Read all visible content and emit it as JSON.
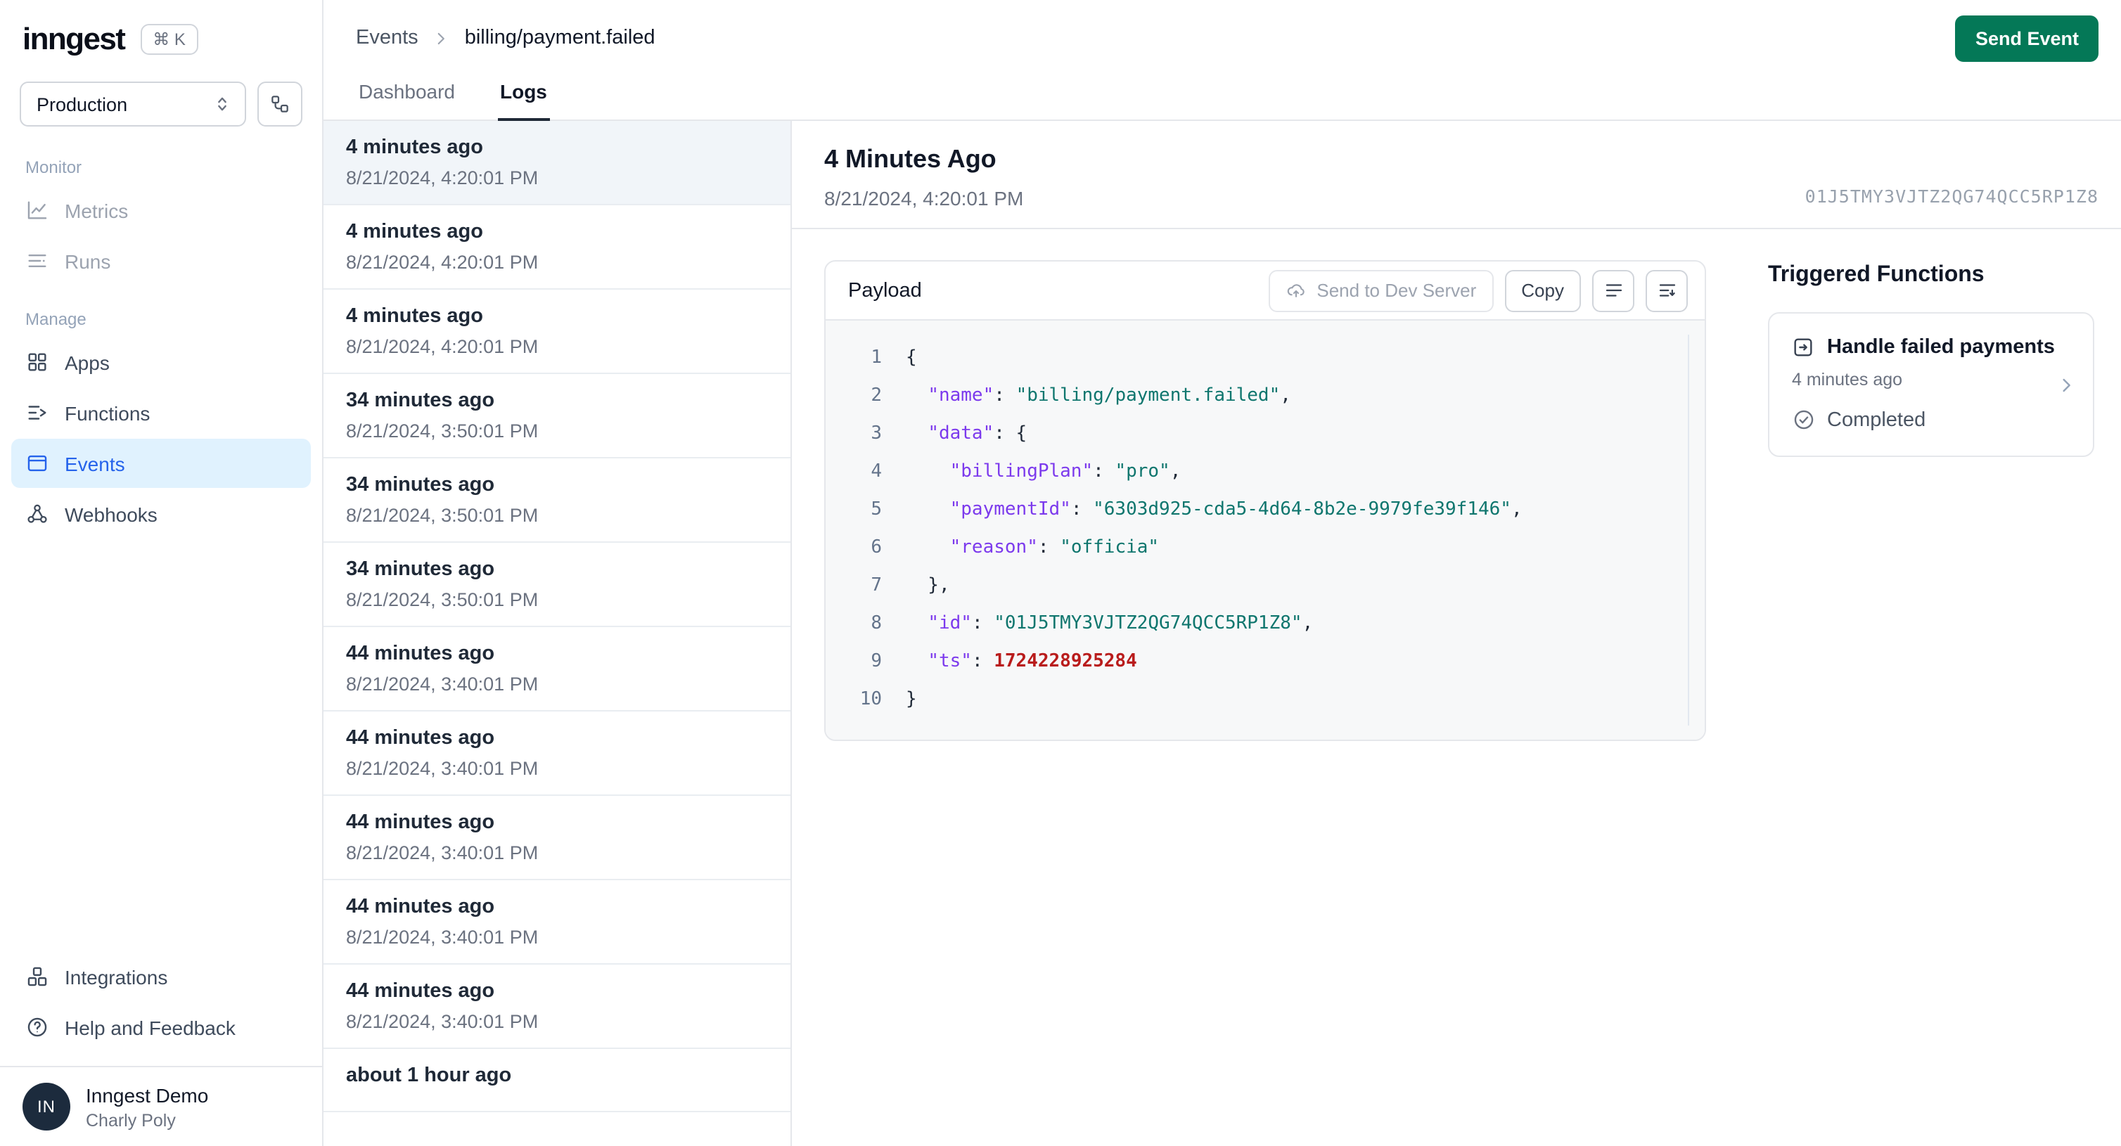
{
  "colors": {
    "accent_green": "#047857",
    "active_blue": "#2563eb",
    "active_blue_bg": "#e0f2fe",
    "selected_item_bg": "#f1f5f9",
    "code_key": "#7c3aed",
    "code_string": "#0f766e",
    "code_number": "#b91c1c",
    "avatar_bg": "#1c2b3d"
  },
  "sidebar": {
    "logo": "inngest",
    "shortcut": "⌘ K",
    "environment": {
      "value": "Production"
    },
    "sections": [
      {
        "label": "Monitor",
        "items": [
          {
            "label": "Metrics",
            "icon": "metrics-icon"
          },
          {
            "label": "Runs",
            "icon": "runs-icon"
          }
        ]
      },
      {
        "label": "Manage",
        "items": [
          {
            "label": "Apps",
            "icon": "apps-icon"
          },
          {
            "label": "Functions",
            "icon": "functions-icon"
          },
          {
            "label": "Events",
            "icon": "events-icon"
          },
          {
            "label": "Webhooks",
            "icon": "webhooks-icon"
          }
        ]
      }
    ],
    "footer_items": [
      {
        "label": "Integrations",
        "icon": "integrations-icon"
      },
      {
        "label": "Help and Feedback",
        "icon": "help-icon"
      }
    ],
    "user": {
      "initials": "IN",
      "name": "Inngest Demo",
      "subtitle": "Charly Poly"
    }
  },
  "header": {
    "breadcrumb": {
      "parent": "Events",
      "current": "billing/payment.failed"
    },
    "send_event_label": "Send Event",
    "tabs": [
      {
        "label": "Dashboard",
        "active": false
      },
      {
        "label": "Logs",
        "active": true
      }
    ]
  },
  "event_list": {
    "items": [
      {
        "title": "4 minutes ago",
        "timestamp": "8/21/2024, 4:20:01 PM",
        "selected": true
      },
      {
        "title": "4 minutes ago",
        "timestamp": "8/21/2024, 4:20:01 PM"
      },
      {
        "title": "4 minutes ago",
        "timestamp": "8/21/2024, 4:20:01 PM"
      },
      {
        "title": "34 minutes ago",
        "timestamp": "8/21/2024, 3:50:01 PM"
      },
      {
        "title": "34 minutes ago",
        "timestamp": "8/21/2024, 3:50:01 PM"
      },
      {
        "title": "34 minutes ago",
        "timestamp": "8/21/2024, 3:50:01 PM"
      },
      {
        "title": "44 minutes ago",
        "timestamp": "8/21/2024, 3:40:01 PM"
      },
      {
        "title": "44 minutes ago",
        "timestamp": "8/21/2024, 3:40:01 PM"
      },
      {
        "title": "44 minutes ago",
        "timestamp": "8/21/2024, 3:40:01 PM"
      },
      {
        "title": "44 minutes ago",
        "timestamp": "8/21/2024, 3:40:01 PM"
      },
      {
        "title": "44 minutes ago",
        "timestamp": "8/21/2024, 3:40:01 PM"
      },
      {
        "title": "about 1 hour ago",
        "timestamp": ""
      }
    ]
  },
  "detail": {
    "title": "4 Minutes Ago",
    "timestamp": "8/21/2024, 4:20:01 PM",
    "event_id": "01J5TMY3VJTZ2QG74QCC5RP1Z8",
    "payload": {
      "title": "Payload",
      "send_to_dev_server_label": "Send to Dev Server",
      "copy_label": "Copy",
      "code_lines": [
        [
          [
            "p",
            "{"
          ]
        ],
        [
          [
            "p",
            "  "
          ],
          [
            "k",
            "\"name\""
          ],
          [
            "p",
            ": "
          ],
          [
            "s",
            "\"billing/payment.failed\""
          ],
          [
            "p",
            ","
          ]
        ],
        [
          [
            "p",
            "  "
          ],
          [
            "k",
            "\"data\""
          ],
          [
            "p",
            ": {"
          ]
        ],
        [
          [
            "p",
            "    "
          ],
          [
            "k",
            "\"billingPlan\""
          ],
          [
            "p",
            ": "
          ],
          [
            "s",
            "\"pro\""
          ],
          [
            "p",
            ","
          ]
        ],
        [
          [
            "p",
            "    "
          ],
          [
            "k",
            "\"paymentId\""
          ],
          [
            "p",
            ": "
          ],
          [
            "s",
            "\"6303d925-cda5-4d64-8b2e-9979fe39f146\""
          ],
          [
            "p",
            ","
          ]
        ],
        [
          [
            "p",
            "    "
          ],
          [
            "k",
            "\"reason\""
          ],
          [
            "p",
            ": "
          ],
          [
            "s",
            "\"officia\""
          ]
        ],
        [
          [
            "p",
            "  },"
          ]
        ],
        [
          [
            "p",
            "  "
          ],
          [
            "k",
            "\"id\""
          ],
          [
            "p",
            ": "
          ],
          [
            "s",
            "\"01J5TMY3VJTZ2QG74QCC5RP1Z8\""
          ],
          [
            "p",
            ","
          ]
        ],
        [
          [
            "p",
            "  "
          ],
          [
            "k",
            "\"ts\""
          ],
          [
            "p",
            ": "
          ],
          [
            "n",
            "1724228925284"
          ]
        ],
        [
          [
            "p",
            "}"
          ]
        ]
      ]
    },
    "triggered_functions": {
      "title": "Triggered Functions",
      "items": [
        {
          "name": "Handle failed payments",
          "time": "4 minutes ago",
          "status": "Completed"
        }
      ]
    }
  }
}
